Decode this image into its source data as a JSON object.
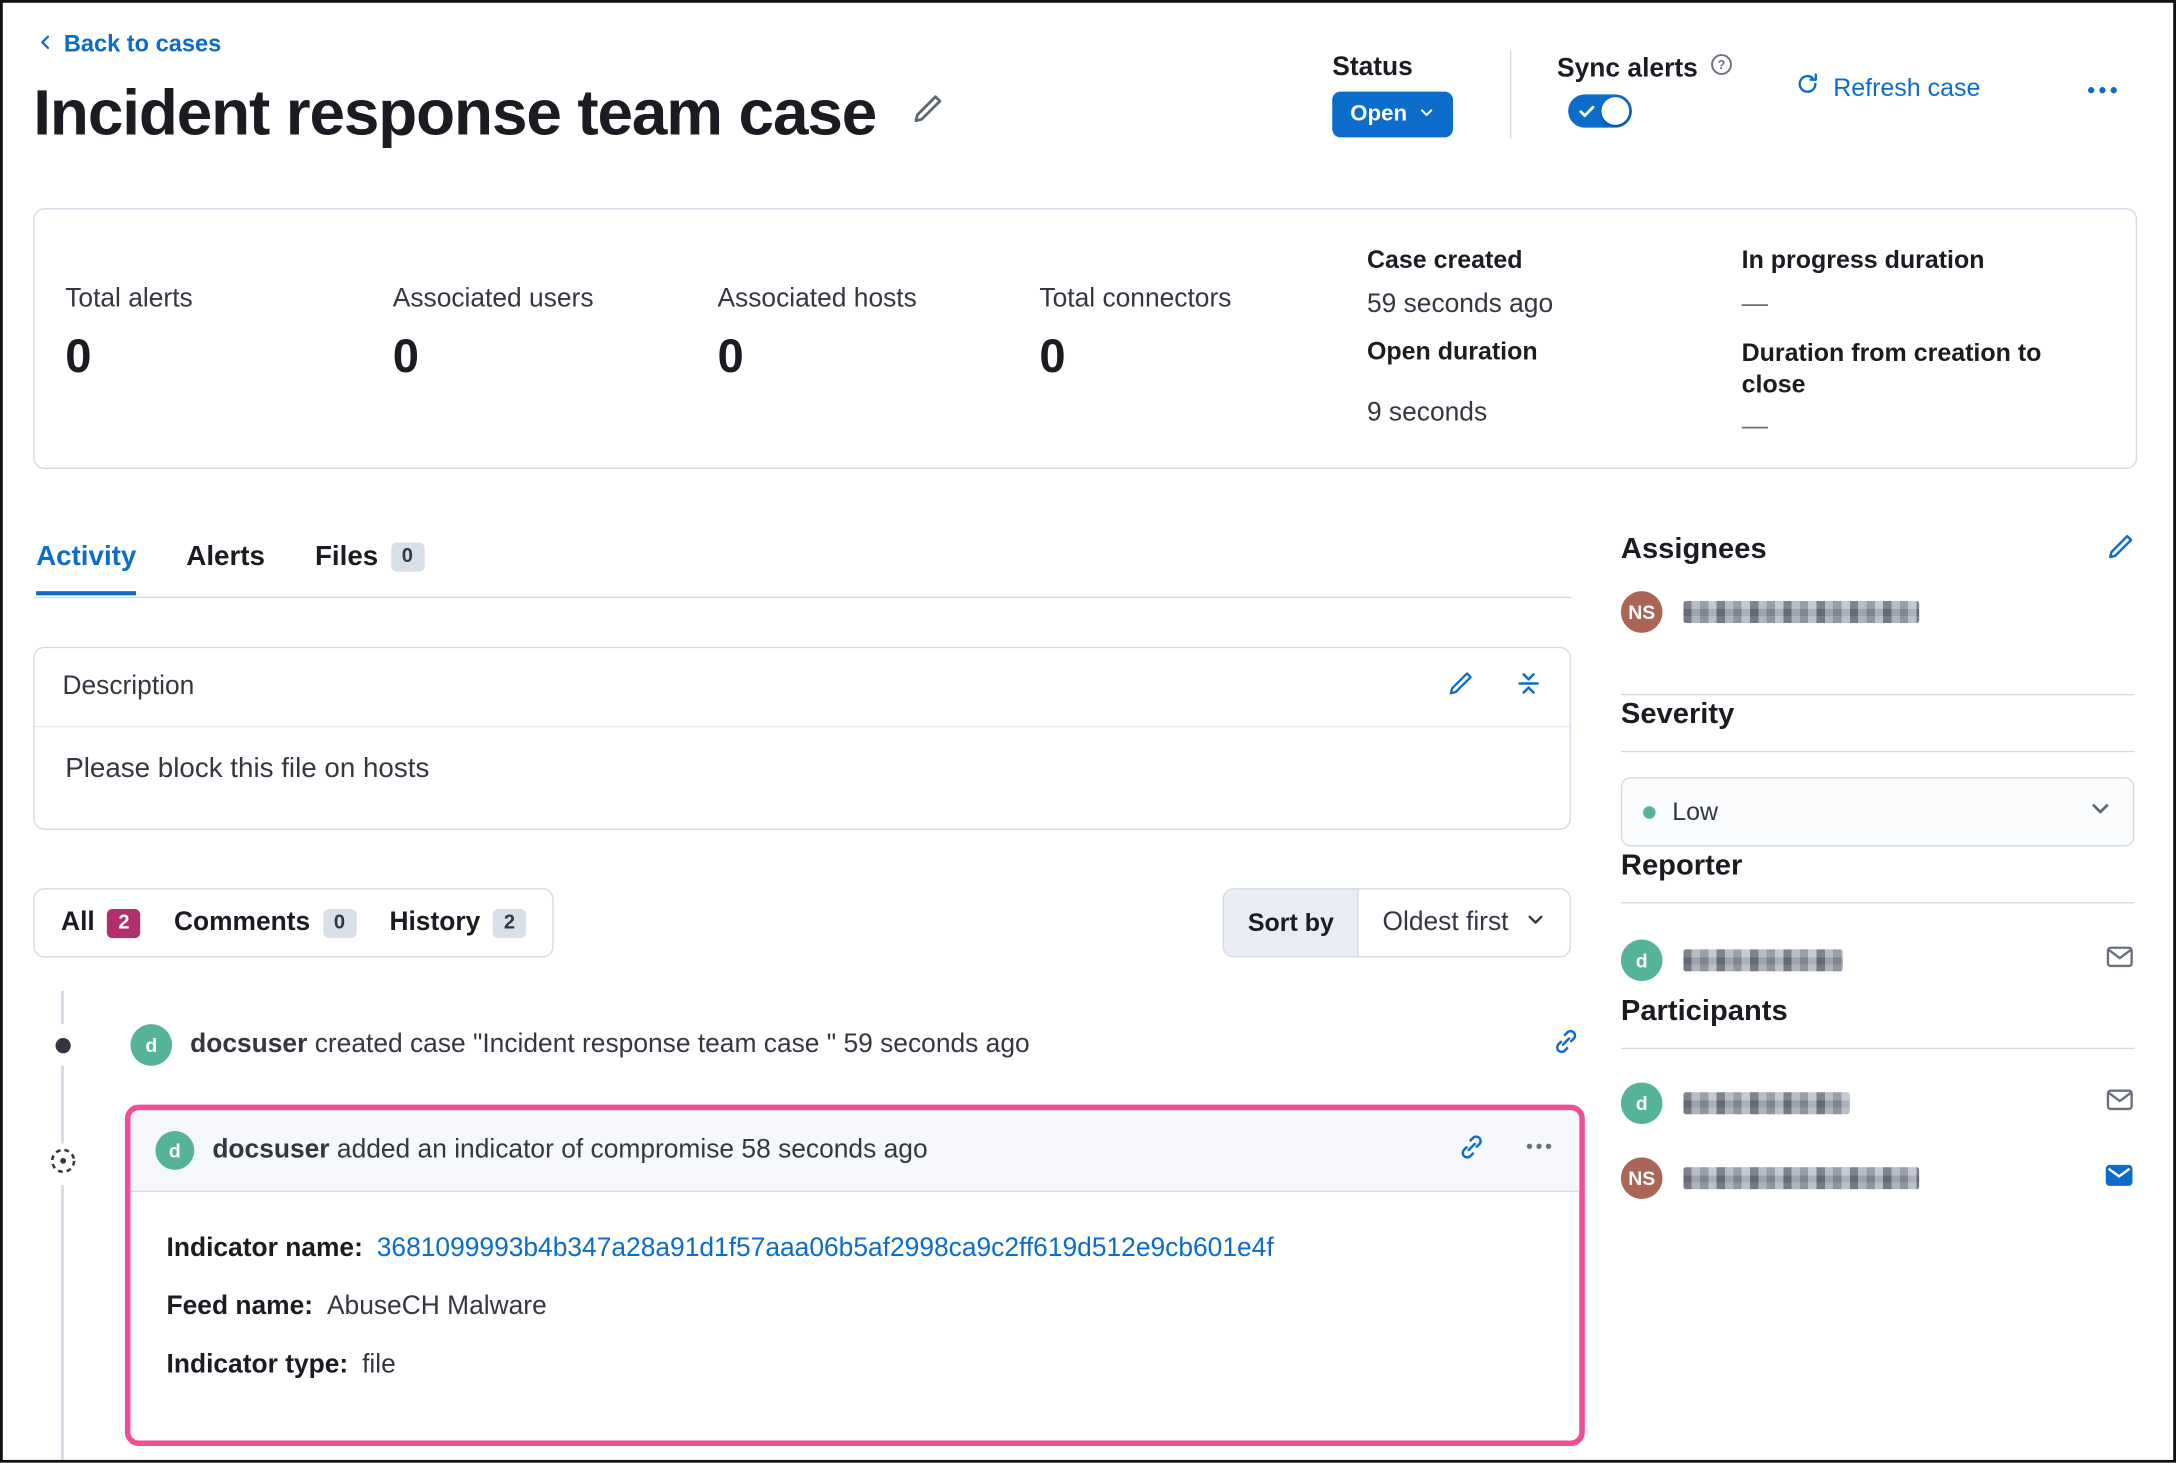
{
  "header": {
    "back_link": "Back to cases",
    "title": "Incident response team case",
    "status_label": "Status",
    "status_value": "Open",
    "sync_alerts_label": "Sync alerts",
    "refresh_label": "Refresh case"
  },
  "summary": {
    "stats": [
      {
        "label": "Total alerts",
        "value": "0"
      },
      {
        "label": "Associated users",
        "value": "0"
      },
      {
        "label": "Associated hosts",
        "value": "0"
      },
      {
        "label": "Total connectors",
        "value": "0"
      }
    ],
    "timing": [
      {
        "label": "Case created",
        "value": "59 seconds ago"
      },
      {
        "label": "Open duration",
        "value": "9 seconds"
      },
      {
        "label": "In progress duration",
        "value": "—"
      },
      {
        "label": "Duration from creation to close",
        "value": "—"
      }
    ]
  },
  "tabs": [
    {
      "label": "Activity",
      "active": true
    },
    {
      "label": "Alerts"
    },
    {
      "label": "Files",
      "badge": "0"
    }
  ],
  "description_panel": {
    "title": "Description",
    "body": "Please block this file on hosts"
  },
  "filter_bar": {
    "filters": [
      {
        "label": "All",
        "count": "2"
      },
      {
        "label": "Comments",
        "count": "0"
      },
      {
        "label": "History",
        "count": "2"
      }
    ],
    "sort_label": "Sort by",
    "sort_value": "Oldest first"
  },
  "timeline": [
    {
      "avatar": "d",
      "user": "docsuser",
      "action": "created case \"Incident response team case \" 59 seconds ago"
    },
    {
      "avatar": "d",
      "user": "docsuser",
      "action": "added an indicator of compromise 58 seconds ago",
      "fields": [
        {
          "label": "Indicator name:",
          "value": "3681099993b4b347a28a91d1f57aaa06b5af2998ca9c2ff619d512e9cb601e4f"
        },
        {
          "label": "Feed name:",
          "value": "AbuseCH Malware"
        },
        {
          "label": "Indicator type:",
          "value": "file"
        }
      ]
    }
  ],
  "sidebar": {
    "assignees": {
      "title": "Assignees",
      "users": [
        {
          "initials": "NS",
          "name_redacted": true
        }
      ]
    },
    "severity": {
      "title": "Severity",
      "value": "Low"
    },
    "reporter": {
      "title": "Reporter",
      "users": [
        {
          "initials": "d",
          "name_redacted": true
        }
      ]
    },
    "participants": {
      "title": "Participants",
      "users": [
        {
          "initials": "d",
          "name_redacted": true
        },
        {
          "initials": "NS",
          "name_redacted": true
        }
      ]
    }
  },
  "colors": {
    "primary_blue": "#0b6cca",
    "highlight_pink": "#f04e98",
    "accent_badge": "#b0306a",
    "severity_low": "#54b399",
    "avatar_green": "#54b399",
    "avatar_brown": "#aa6556",
    "border": "#d3dae6"
  }
}
